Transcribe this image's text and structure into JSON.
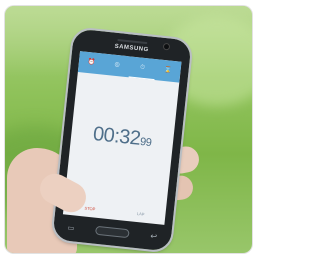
{
  "photo": {
    "description_colors": {
      "background_grass": "#8fc25a",
      "phone_body": "#1f2326",
      "screen_bg": "#eef1f4",
      "tabbar": "#59a5d6",
      "time_text": "#4f6f8a"
    }
  },
  "phone": {
    "brand": "SAMSUNG",
    "tabs": [
      {
        "icon": "alarm-icon",
        "glyph": "⏰"
      },
      {
        "icon": "world-clock-icon",
        "glyph": "◎"
      },
      {
        "icon": "stopwatch-icon",
        "glyph": "⏱"
      },
      {
        "icon": "timer-icon",
        "glyph": "⌛"
      }
    ],
    "stopwatch": {
      "time": "00:32",
      "hundredths": "99"
    },
    "buttons": {
      "left": "STOP",
      "right": "LAP"
    },
    "nav": {
      "recent_glyph": "▭",
      "back_glyph": "↩"
    }
  }
}
